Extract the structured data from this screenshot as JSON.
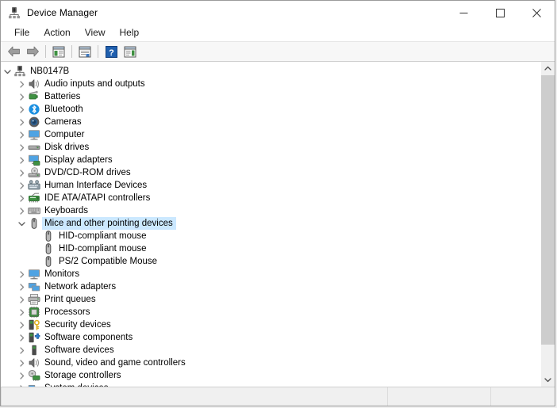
{
  "window": {
    "title": "Device Manager",
    "app_icon": "device-manager-icon",
    "minimize_label": "Minimize",
    "maximize_label": "Maximize",
    "close_label": "Close"
  },
  "menubar": {
    "items": [
      {
        "label": "File",
        "name": "menu-file"
      },
      {
        "label": "Action",
        "name": "menu-action"
      },
      {
        "label": "View",
        "name": "menu-view"
      },
      {
        "label": "Help",
        "name": "menu-help"
      }
    ]
  },
  "toolbar": {
    "buttons": [
      {
        "icon": "back-arrow-icon",
        "tooltip": "Back"
      },
      {
        "icon": "forward-arrow-icon",
        "tooltip": "Forward"
      },
      {
        "icon": "show-hide-console-tree-icon",
        "tooltip": "Show/hide console tree"
      },
      {
        "icon": "properties-icon",
        "tooltip": "Properties"
      },
      {
        "icon": "help-icon",
        "tooltip": "Help"
      },
      {
        "icon": "scan-for-hardware-changes-icon",
        "tooltip": "Scan for hardware changes"
      }
    ]
  },
  "tree": {
    "root": {
      "label": "NB0147B",
      "icon": "computer-root-icon",
      "expanded": true,
      "indent": 0
    },
    "items": [
      {
        "label": "Audio inputs and outputs",
        "icon": "speaker-icon",
        "expanded": false,
        "indent": 1,
        "selected": false
      },
      {
        "label": "Batteries",
        "icon": "battery-icon",
        "expanded": false,
        "indent": 1,
        "selected": false
      },
      {
        "label": "Bluetooth",
        "icon": "bluetooth-icon",
        "expanded": false,
        "indent": 1,
        "selected": false
      },
      {
        "label": "Cameras",
        "icon": "camera-icon",
        "expanded": false,
        "indent": 1,
        "selected": false
      },
      {
        "label": "Computer",
        "icon": "monitor-icon",
        "expanded": false,
        "indent": 1,
        "selected": false
      },
      {
        "label": "Disk drives",
        "icon": "disk-drive-icon",
        "expanded": false,
        "indent": 1,
        "selected": false
      },
      {
        "label": "Display adapters",
        "icon": "display-adapter-icon",
        "expanded": false,
        "indent": 1,
        "selected": false
      },
      {
        "label": "DVD/CD-ROM drives",
        "icon": "optical-drive-icon",
        "expanded": false,
        "indent": 1,
        "selected": false
      },
      {
        "label": "Human Interface Devices",
        "icon": "hid-icon",
        "expanded": false,
        "indent": 1,
        "selected": false
      },
      {
        "label": "IDE ATA/ATAPI controllers",
        "icon": "ide-controller-icon",
        "expanded": false,
        "indent": 1,
        "selected": false
      },
      {
        "label": "Keyboards",
        "icon": "keyboard-icon",
        "expanded": false,
        "indent": 1,
        "selected": false
      },
      {
        "label": "Mice and other pointing devices",
        "icon": "mouse-icon",
        "expanded": true,
        "indent": 1,
        "selected": true
      },
      {
        "label": "HID-compliant mouse",
        "icon": "mouse-icon",
        "expanded": null,
        "indent": 2,
        "selected": false
      },
      {
        "label": "HID-compliant mouse",
        "icon": "mouse-icon",
        "expanded": null,
        "indent": 2,
        "selected": false
      },
      {
        "label": "PS/2 Compatible Mouse",
        "icon": "mouse-icon",
        "expanded": null,
        "indent": 2,
        "selected": false
      },
      {
        "label": "Monitors",
        "icon": "monitor-icon",
        "expanded": false,
        "indent": 1,
        "selected": false
      },
      {
        "label": "Network adapters",
        "icon": "network-adapter-icon",
        "expanded": false,
        "indent": 1,
        "selected": false
      },
      {
        "label": "Print queues",
        "icon": "printer-icon",
        "expanded": false,
        "indent": 1,
        "selected": false
      },
      {
        "label": "Processors",
        "icon": "processor-icon",
        "expanded": false,
        "indent": 1,
        "selected": false
      },
      {
        "label": "Security devices",
        "icon": "security-device-icon",
        "expanded": false,
        "indent": 1,
        "selected": false
      },
      {
        "label": "Software components",
        "icon": "software-component-icon",
        "expanded": false,
        "indent": 1,
        "selected": false
      },
      {
        "label": "Software devices",
        "icon": "software-device-icon",
        "expanded": false,
        "indent": 1,
        "selected": false
      },
      {
        "label": "Sound, video and game controllers",
        "icon": "speaker-icon",
        "expanded": false,
        "indent": 1,
        "selected": false
      },
      {
        "label": "Storage controllers",
        "icon": "storage-controller-icon",
        "expanded": false,
        "indent": 1,
        "selected": false
      },
      {
        "label": "System devices",
        "icon": "system-device-icon",
        "expanded": false,
        "indent": 1,
        "selected": false
      }
    ]
  },
  "scrollbar": {
    "up_icon": "chevron-up-icon",
    "down_icon": "chevron-down-icon"
  },
  "statusbar": {
    "panes": [
      "",
      "",
      ""
    ]
  },
  "colors": {
    "selection": "#cbe8ff",
    "window_bg": "#ffffff",
    "chrome_bg": "#f0f0f0"
  }
}
